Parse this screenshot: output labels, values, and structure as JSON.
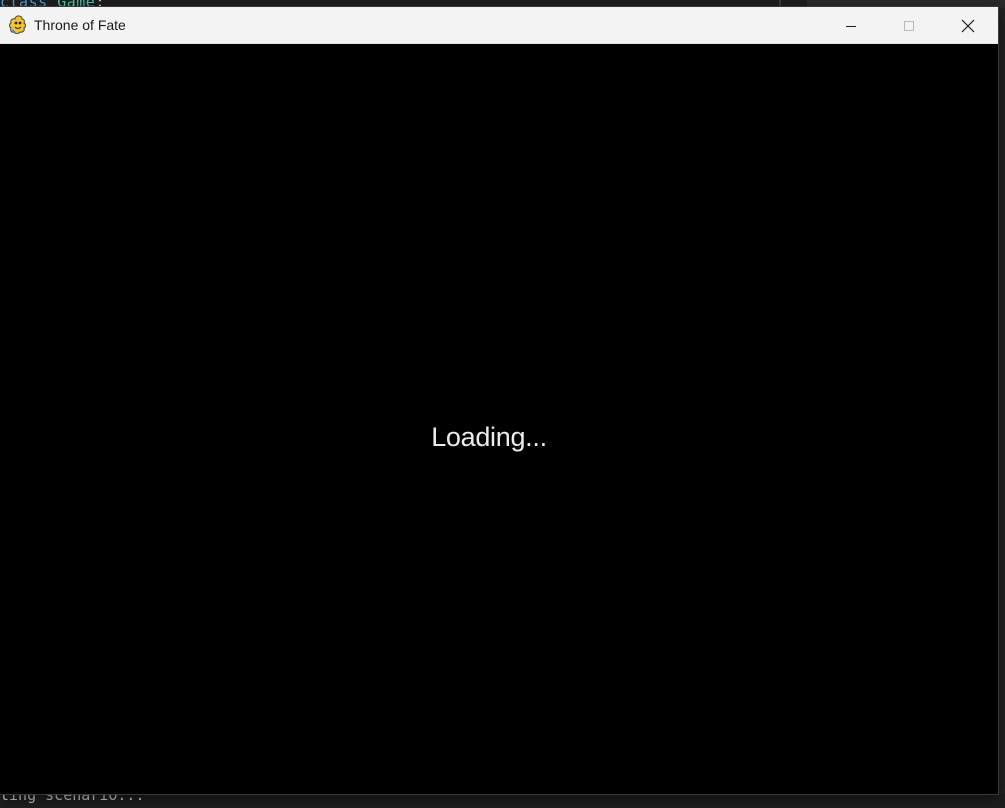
{
  "background": {
    "code_keyword": "class",
    "code_name": "Game",
    "code_punct": ":",
    "terminal_text": "ting scenario..."
  },
  "window": {
    "title": "Throne of Fate",
    "app_icon": "pygame-snake-icon",
    "controls": {
      "minimize": "minimize-icon",
      "maximize": "maximize-icon",
      "close": "close-icon"
    }
  },
  "game": {
    "loading_text": "Loading..."
  },
  "colors": {
    "canvas": "#000000",
    "title_bar": "#f3f3f3",
    "loading_text": "#ececec"
  }
}
